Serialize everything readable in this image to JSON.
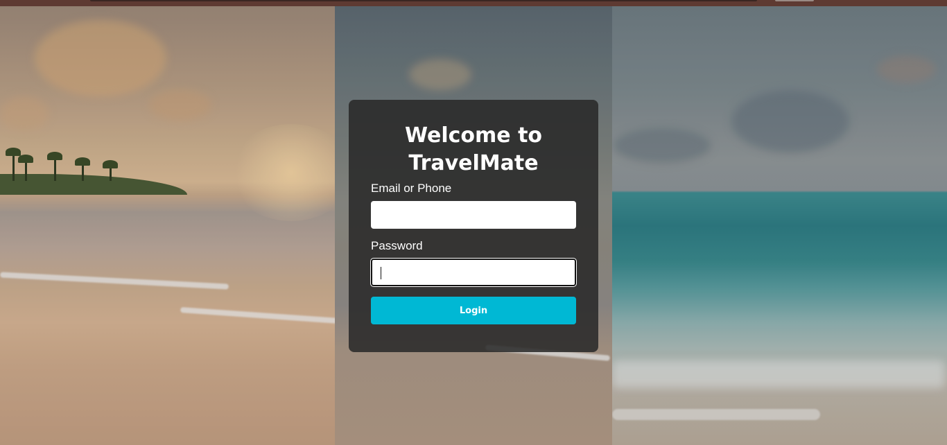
{
  "login": {
    "title_line1": "Welcome to",
    "title_line2": "TravelMate",
    "email_label": "Email or Phone",
    "email_value": "",
    "password_label": "Password",
    "password_value": "",
    "login_button": "Login"
  },
  "colors": {
    "card_background": "#282828",
    "button_accent": "#00b8d4",
    "browser_bar": "#5e3a32"
  }
}
